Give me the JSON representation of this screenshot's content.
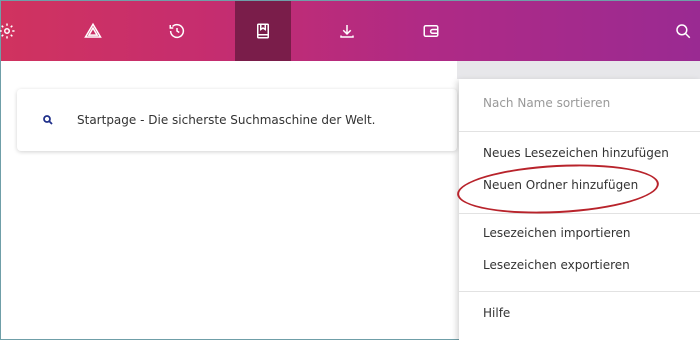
{
  "toolbar": {
    "background_start": "#d0335f",
    "background_end": "#9a2a92",
    "active_color": "#7a1d4a",
    "buttons": [
      {
        "icon": "gear-icon",
        "active": false
      },
      {
        "icon": "warning-triangle-icon",
        "active": false
      },
      {
        "icon": "history-icon",
        "active": false
      },
      {
        "icon": "bookmarks-icon",
        "active": true
      },
      {
        "icon": "download-icon",
        "active": false
      },
      {
        "icon": "wallet-icon",
        "active": false
      },
      {
        "icon": "search-icon",
        "active": false
      }
    ]
  },
  "bookmarks": [
    {
      "title": "Startpage - Die sicherste Suchmaschine der Welt.",
      "icon": "search-icon"
    }
  ],
  "context_menu": {
    "items": [
      {
        "label": "Nach Name sortieren",
        "enabled": false
      },
      {
        "label": "Neues Lesezeichen hinzufügen",
        "enabled": true
      },
      {
        "label": "Neuen Ordner hinzufügen",
        "enabled": true,
        "highlighted": true
      },
      {
        "label": "Lesezeichen importieren",
        "enabled": true
      },
      {
        "label": "Lesezeichen exportieren",
        "enabled": true
      },
      {
        "label": "Hilfe",
        "enabled": true
      }
    ]
  },
  "highlight_color": "#b8232b"
}
